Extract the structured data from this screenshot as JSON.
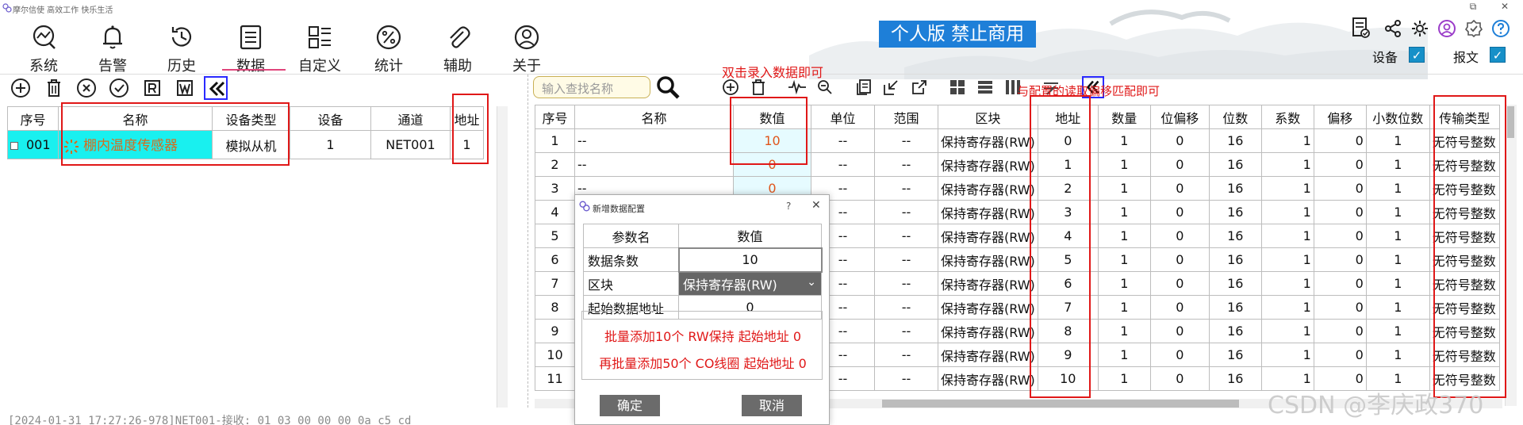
{
  "app": {
    "title": "摩尔信使 高效工作 快乐生活",
    "banner": "个人版 禁止商用"
  },
  "window": {
    "restore": "⧉",
    "close": "✕"
  },
  "menu": [
    {
      "label": "系统",
      "icon": "system-icon"
    },
    {
      "label": "告警",
      "icon": "bell-icon"
    },
    {
      "label": "历史",
      "icon": "history-icon"
    },
    {
      "label": "数据",
      "icon": "data-icon",
      "active": true
    },
    {
      "label": "自定义",
      "icon": "custom-icon"
    },
    {
      "label": "统计",
      "icon": "percent-icon"
    },
    {
      "label": "辅助",
      "icon": "paperclip-icon"
    },
    {
      "label": "关于",
      "icon": "user-icon"
    }
  ],
  "toggles": [
    {
      "label": "设备",
      "checked": true
    },
    {
      "label": "报文",
      "checked": true
    }
  ],
  "left_table": {
    "headers": [
      "序号",
      "名称",
      "设备类型",
      "设备",
      "通道",
      "地址"
    ],
    "rows": [
      {
        "index": "001",
        "name": "棚内温度传感器",
        "type": "模拟从机",
        "device": "1",
        "channel": "NET001",
        "address": "1"
      }
    ]
  },
  "search": {
    "placeholder": "输入查找名称"
  },
  "annotations": {
    "double_click": "双击录入数据即可",
    "match_offset": "与配置的读取偏移匹配即可"
  },
  "right_table": {
    "headers": [
      "序号",
      "名称",
      "数值",
      "单位",
      "范围",
      "区块",
      "地址",
      "数量",
      "位偏移",
      "位数",
      "系数",
      "偏移",
      "小数位数",
      "传输类型"
    ],
    "rows": [
      [
        "1",
        "--",
        "10",
        "--",
        "--",
        "保持寄存器(RW)",
        "0",
        "1",
        "0",
        "16",
        "1",
        "0",
        "1",
        "无符号整数"
      ],
      [
        "2",
        "--",
        "0",
        "--",
        "--",
        "保持寄存器(RW)",
        "1",
        "1",
        "0",
        "16",
        "1",
        "0",
        "1",
        "无符号整数"
      ],
      [
        "3",
        "--",
        "0",
        "--",
        "--",
        "保持寄存器(RW)",
        "2",
        "1",
        "0",
        "16",
        "1",
        "0",
        "1",
        "无符号整数"
      ],
      [
        "4",
        "--",
        "",
        "--",
        "--",
        "保持寄存器(RW)",
        "3",
        "1",
        "0",
        "16",
        "1",
        "0",
        "1",
        "无符号整数"
      ],
      [
        "5",
        "--",
        "",
        "--",
        "--",
        "保持寄存器(RW)",
        "4",
        "1",
        "0",
        "16",
        "1",
        "0",
        "1",
        "无符号整数"
      ],
      [
        "6",
        "--",
        "",
        "--",
        "--",
        "保持寄存器(RW)",
        "5",
        "1",
        "0",
        "16",
        "1",
        "0",
        "1",
        "无符号整数"
      ],
      [
        "7",
        "--",
        "",
        "--",
        "--",
        "保持寄存器(RW)",
        "6",
        "1",
        "0",
        "16",
        "1",
        "0",
        "1",
        "无符号整数"
      ],
      [
        "8",
        "--",
        "",
        "--",
        "--",
        "保持寄存器(RW)",
        "7",
        "1",
        "0",
        "16",
        "1",
        "0",
        "1",
        "无符号整数"
      ],
      [
        "9",
        "--",
        "",
        "--",
        "--",
        "保持寄存器(RW)",
        "8",
        "1",
        "0",
        "16",
        "1",
        "0",
        "1",
        "无符号整数"
      ],
      [
        "10",
        "--",
        "",
        "--",
        "--",
        "保持寄存器(RW)",
        "9",
        "1",
        "0",
        "16",
        "1",
        "0",
        "1",
        "无符号整数"
      ],
      [
        "11",
        "--",
        "",
        "--",
        "--",
        "保持寄存器(RW)",
        "10",
        "1",
        "0",
        "16",
        "1",
        "0",
        "1",
        "无符号整数"
      ]
    ]
  },
  "log": {
    "line": "[2024-01-31 17:27:26-978]NET001-接收: 01 03 00 00 00 0a c5 cd"
  },
  "dialog": {
    "title": "新增数据配置",
    "help": "?",
    "close": "✕",
    "headers": [
      "参数名",
      "数值"
    ],
    "rows": [
      {
        "name": "数据条数",
        "value": "10"
      },
      {
        "name": "区块",
        "value": "保持寄存器(RW)"
      },
      {
        "name": "起始数据地址",
        "value": "0"
      }
    ],
    "notes": [
      "批量添加10个 RW保持  起始地址 0",
      "再批量添加50个 CO线圈 起始地址 0"
    ],
    "ok": "确定",
    "cancel": "取消"
  },
  "watermark": "CSDN @李庆政370",
  "colors": {
    "accent": "#1e7fd8",
    "highlight": "#e01818",
    "selected_row": "#19f0ef",
    "value_text": "#e0551b"
  }
}
